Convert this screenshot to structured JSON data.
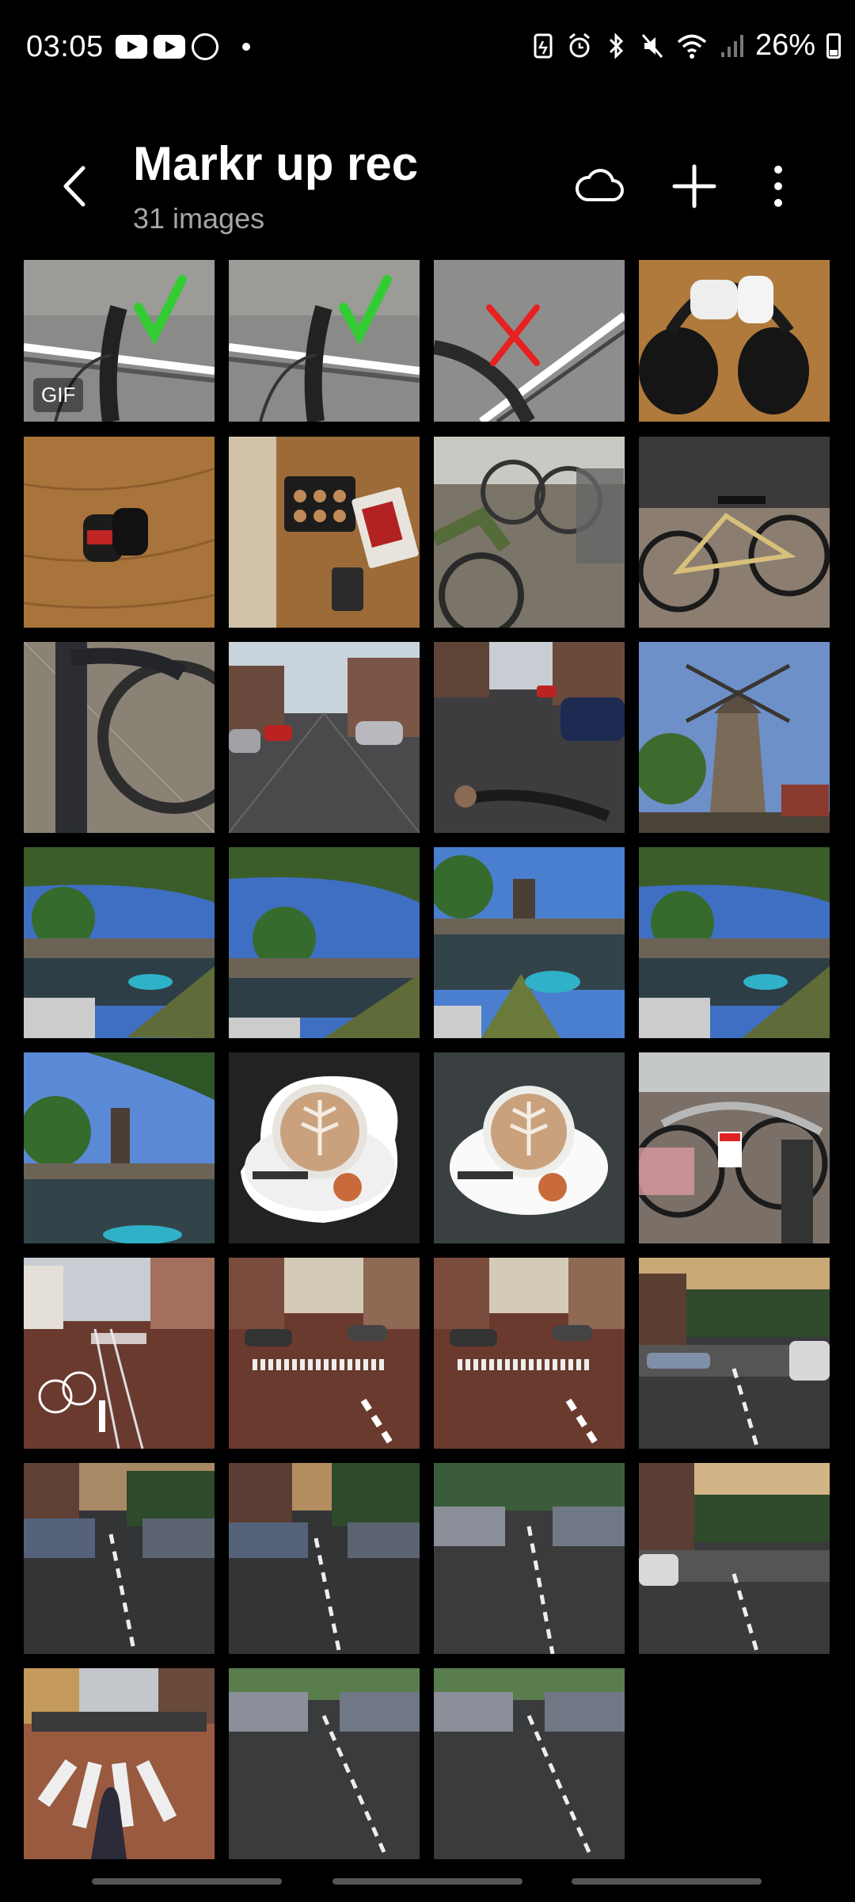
{
  "status_bar": {
    "time": "03:05",
    "battery_percent": "26%",
    "left_icons": [
      "youtube-icon",
      "youtube-icon",
      "whatsapp-icon",
      "notification-dot-icon"
    ],
    "right_icons": [
      "battery-saver-icon",
      "alarm-icon",
      "bluetooth-icon",
      "mute-icon",
      "wifi-icon",
      "signal-icon",
      "battery-icon"
    ]
  },
  "header": {
    "title": "Markr up rec",
    "subtitle": "31 images",
    "actions": [
      "back-icon",
      "cloud-icon",
      "add-icon",
      "more-icon"
    ]
  },
  "album": {
    "thumbnails": [
      {
        "subject": "bike-handlebar-check",
        "badge": "GIF"
      },
      {
        "subject": "bike-handlebar-check",
        "badge": ""
      },
      {
        "subject": "bike-handlebar-cross",
        "badge": ""
      },
      {
        "subject": "headphones-earbuds",
        "badge": ""
      },
      {
        "subject": "bike-lights",
        "badge": ""
      },
      {
        "subject": "repair-kit",
        "badge": ""
      },
      {
        "subject": "parked-bikes",
        "badge": ""
      },
      {
        "subject": "bike-at-wall",
        "badge": ""
      },
      {
        "subject": "bike-wheel-closeup",
        "badge": ""
      },
      {
        "subject": "wet-street",
        "badge": ""
      },
      {
        "subject": "wet-street-ride",
        "badge": ""
      },
      {
        "subject": "windmill",
        "badge": ""
      },
      {
        "subject": "canal-view",
        "badge": ""
      },
      {
        "subject": "canal-view",
        "badge": ""
      },
      {
        "subject": "canal-windmill",
        "badge": ""
      },
      {
        "subject": "canal-view",
        "badge": ""
      },
      {
        "subject": "canal-windmill-wide",
        "badge": ""
      },
      {
        "subject": "coffee-cutout",
        "badge": ""
      },
      {
        "subject": "coffee-table",
        "badge": ""
      },
      {
        "subject": "bike-parking",
        "badge": ""
      },
      {
        "subject": "street-crossing",
        "badge": ""
      },
      {
        "subject": "street-crossing",
        "badge": ""
      },
      {
        "subject": "street-crossing",
        "badge": ""
      },
      {
        "subject": "street-sunset",
        "badge": ""
      },
      {
        "subject": "street-parked-cars",
        "badge": ""
      },
      {
        "subject": "street-parked-cars",
        "badge": ""
      },
      {
        "subject": "street-parked-cars",
        "badge": ""
      },
      {
        "subject": "street-sunset",
        "badge": ""
      },
      {
        "subject": "crosswalk-shadow",
        "badge": ""
      },
      {
        "subject": "street-parked-cars",
        "badge": ""
      },
      {
        "subject": "street-parked-cars",
        "badge": ""
      }
    ]
  },
  "colors": {
    "background": "#000000",
    "text": "#ffffff",
    "subtitle": "#a6a6a6",
    "check_mark": "#33cc33",
    "cross_mark": "#e82020"
  }
}
